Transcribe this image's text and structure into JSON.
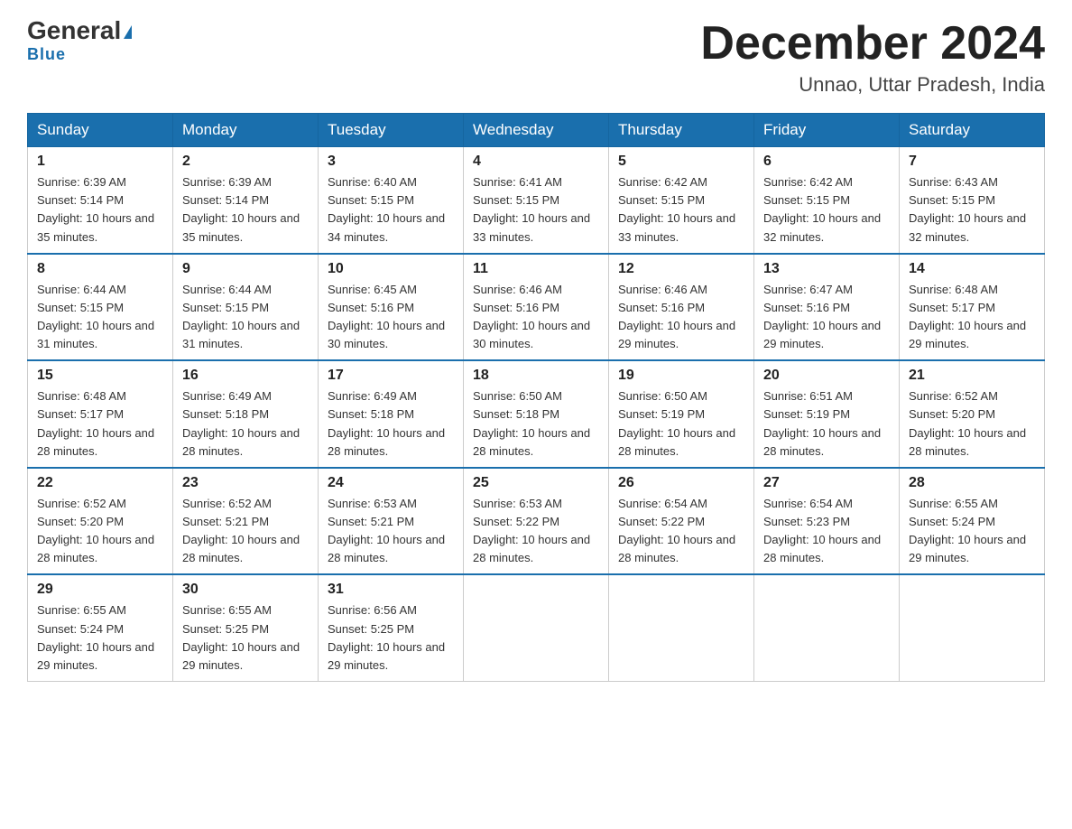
{
  "header": {
    "logo_main": "General",
    "logo_sub": "Blue",
    "month_title": "December 2024",
    "location": "Unnao, Uttar Pradesh, India"
  },
  "days_of_week": [
    "Sunday",
    "Monday",
    "Tuesday",
    "Wednesday",
    "Thursday",
    "Friday",
    "Saturday"
  ],
  "weeks": [
    [
      {
        "day": "1",
        "sunrise": "6:39 AM",
        "sunset": "5:14 PM",
        "daylight": "10 hours and 35 minutes."
      },
      {
        "day": "2",
        "sunrise": "6:39 AM",
        "sunset": "5:14 PM",
        "daylight": "10 hours and 35 minutes."
      },
      {
        "day": "3",
        "sunrise": "6:40 AM",
        "sunset": "5:15 PM",
        "daylight": "10 hours and 34 minutes."
      },
      {
        "day": "4",
        "sunrise": "6:41 AM",
        "sunset": "5:15 PM",
        "daylight": "10 hours and 33 minutes."
      },
      {
        "day": "5",
        "sunrise": "6:42 AM",
        "sunset": "5:15 PM",
        "daylight": "10 hours and 33 minutes."
      },
      {
        "day": "6",
        "sunrise": "6:42 AM",
        "sunset": "5:15 PM",
        "daylight": "10 hours and 32 minutes."
      },
      {
        "day": "7",
        "sunrise": "6:43 AM",
        "sunset": "5:15 PM",
        "daylight": "10 hours and 32 minutes."
      }
    ],
    [
      {
        "day": "8",
        "sunrise": "6:44 AM",
        "sunset": "5:15 PM",
        "daylight": "10 hours and 31 minutes."
      },
      {
        "day": "9",
        "sunrise": "6:44 AM",
        "sunset": "5:15 PM",
        "daylight": "10 hours and 31 minutes."
      },
      {
        "day": "10",
        "sunrise": "6:45 AM",
        "sunset": "5:16 PM",
        "daylight": "10 hours and 30 minutes."
      },
      {
        "day": "11",
        "sunrise": "6:46 AM",
        "sunset": "5:16 PM",
        "daylight": "10 hours and 30 minutes."
      },
      {
        "day": "12",
        "sunrise": "6:46 AM",
        "sunset": "5:16 PM",
        "daylight": "10 hours and 29 minutes."
      },
      {
        "day": "13",
        "sunrise": "6:47 AM",
        "sunset": "5:16 PM",
        "daylight": "10 hours and 29 minutes."
      },
      {
        "day": "14",
        "sunrise": "6:48 AM",
        "sunset": "5:17 PM",
        "daylight": "10 hours and 29 minutes."
      }
    ],
    [
      {
        "day": "15",
        "sunrise": "6:48 AM",
        "sunset": "5:17 PM",
        "daylight": "10 hours and 28 minutes."
      },
      {
        "day": "16",
        "sunrise": "6:49 AM",
        "sunset": "5:18 PM",
        "daylight": "10 hours and 28 minutes."
      },
      {
        "day": "17",
        "sunrise": "6:49 AM",
        "sunset": "5:18 PM",
        "daylight": "10 hours and 28 minutes."
      },
      {
        "day": "18",
        "sunrise": "6:50 AM",
        "sunset": "5:18 PM",
        "daylight": "10 hours and 28 minutes."
      },
      {
        "day": "19",
        "sunrise": "6:50 AM",
        "sunset": "5:19 PM",
        "daylight": "10 hours and 28 minutes."
      },
      {
        "day": "20",
        "sunrise": "6:51 AM",
        "sunset": "5:19 PM",
        "daylight": "10 hours and 28 minutes."
      },
      {
        "day": "21",
        "sunrise": "6:52 AM",
        "sunset": "5:20 PM",
        "daylight": "10 hours and 28 minutes."
      }
    ],
    [
      {
        "day": "22",
        "sunrise": "6:52 AM",
        "sunset": "5:20 PM",
        "daylight": "10 hours and 28 minutes."
      },
      {
        "day": "23",
        "sunrise": "6:52 AM",
        "sunset": "5:21 PM",
        "daylight": "10 hours and 28 minutes."
      },
      {
        "day": "24",
        "sunrise": "6:53 AM",
        "sunset": "5:21 PM",
        "daylight": "10 hours and 28 minutes."
      },
      {
        "day": "25",
        "sunrise": "6:53 AM",
        "sunset": "5:22 PM",
        "daylight": "10 hours and 28 minutes."
      },
      {
        "day": "26",
        "sunrise": "6:54 AM",
        "sunset": "5:22 PM",
        "daylight": "10 hours and 28 minutes."
      },
      {
        "day": "27",
        "sunrise": "6:54 AM",
        "sunset": "5:23 PM",
        "daylight": "10 hours and 28 minutes."
      },
      {
        "day": "28",
        "sunrise": "6:55 AM",
        "sunset": "5:24 PM",
        "daylight": "10 hours and 29 minutes."
      }
    ],
    [
      {
        "day": "29",
        "sunrise": "6:55 AM",
        "sunset": "5:24 PM",
        "daylight": "10 hours and 29 minutes."
      },
      {
        "day": "30",
        "sunrise": "6:55 AM",
        "sunset": "5:25 PM",
        "daylight": "10 hours and 29 minutes."
      },
      {
        "day": "31",
        "sunrise": "6:56 AM",
        "sunset": "5:25 PM",
        "daylight": "10 hours and 29 minutes."
      },
      null,
      null,
      null,
      null
    ]
  ],
  "labels": {
    "sunrise_prefix": "Sunrise: ",
    "sunset_prefix": "Sunset: ",
    "daylight_prefix": "Daylight: "
  }
}
